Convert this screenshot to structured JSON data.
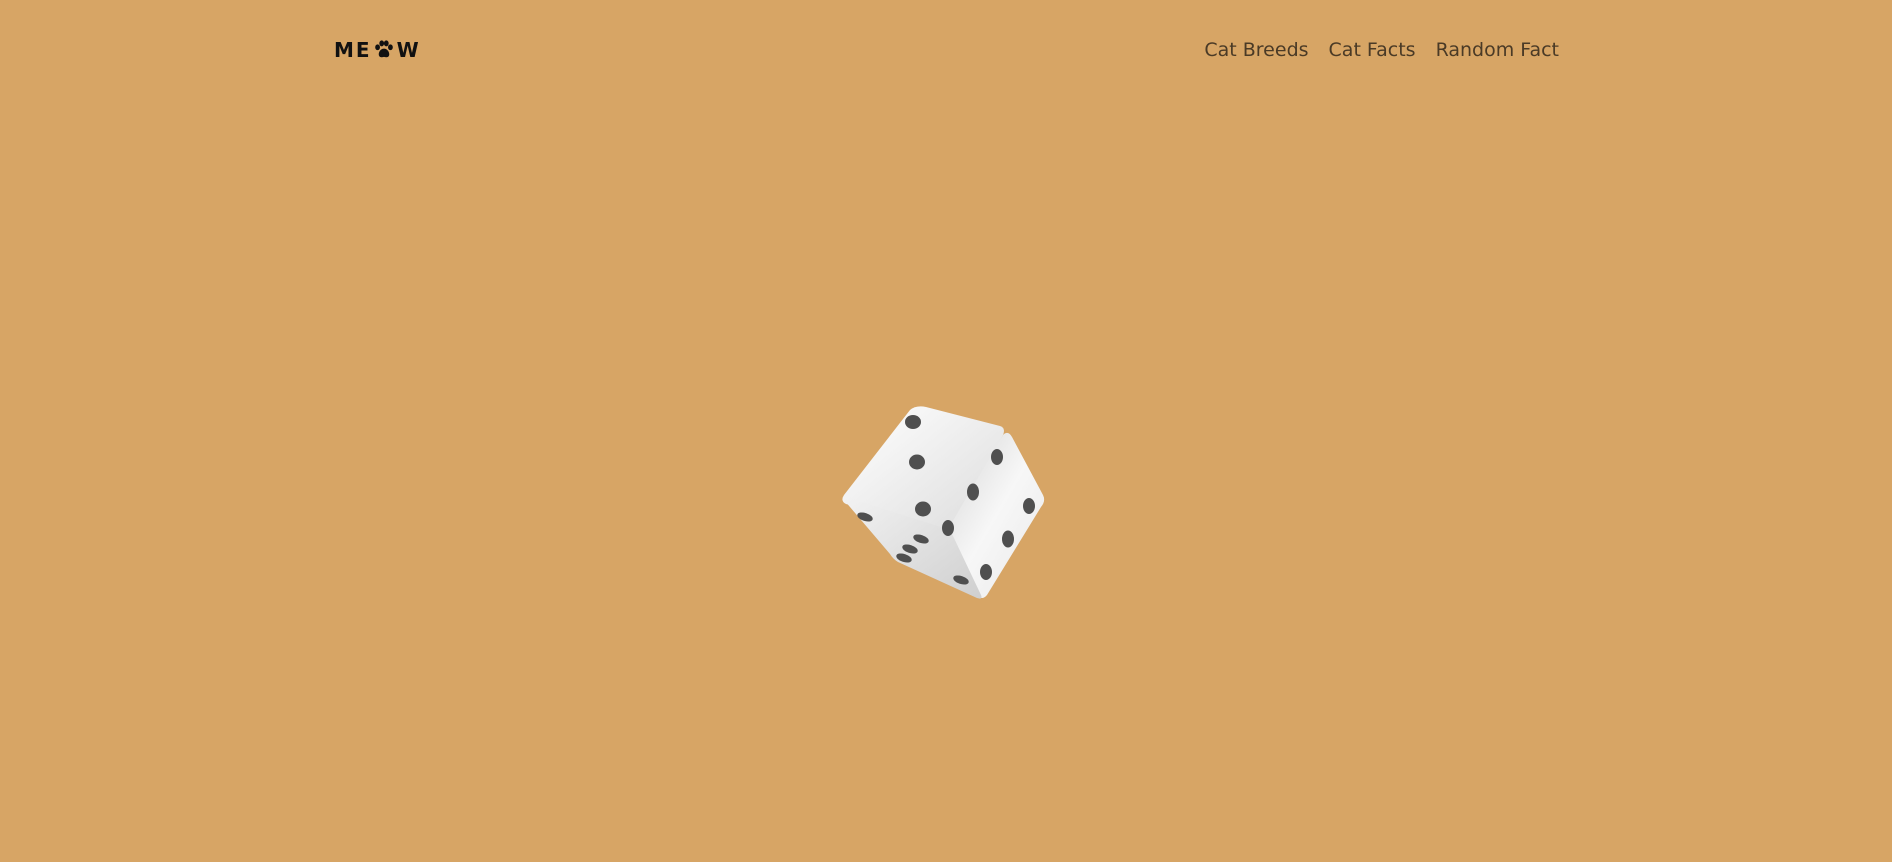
{
  "logo": {
    "letters": [
      "M",
      "E",
      "W"
    ],
    "paw_icon": "paw-icon",
    "alt": "MEOW"
  },
  "nav": {
    "items": [
      {
        "label": "Cat Breeds"
      },
      {
        "label": "Cat Facts"
      },
      {
        "label": "Random Fact"
      }
    ]
  },
  "die": {
    "icon": "dice-icon",
    "faces_visible": [
      3,
      6,
      5
    ]
  },
  "colors": {
    "background": "#d7a565",
    "nav_text": "#4a3a26",
    "logo": "#111111",
    "die_face": "#f4f4f4",
    "die_pip": "#4f4f4f"
  }
}
